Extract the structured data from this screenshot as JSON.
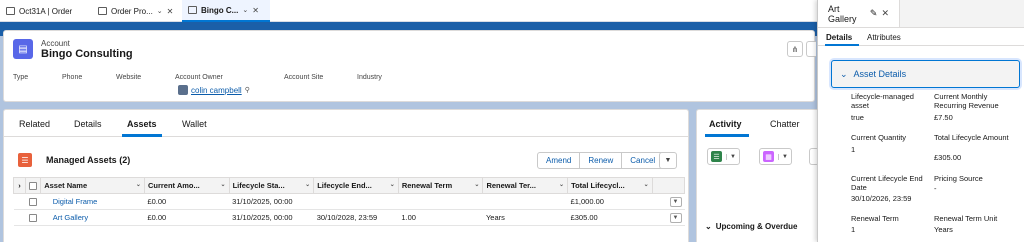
{
  "console_tabs": [
    {
      "label": "Oct31A | Order"
    },
    {
      "label": "Order Pro..."
    },
    {
      "label": "Bingo C..."
    }
  ],
  "header": {
    "object_type": "Account",
    "name": "Bingo Consulting",
    "fields": [
      "Type",
      "Phone",
      "Website",
      "Account Owner",
      "Account Site",
      "Industry"
    ],
    "owner": "colin campbell"
  },
  "related_tabs": [
    "Related",
    "Details",
    "Assets",
    "Wallet"
  ],
  "managed_assets": {
    "title": "Managed Assets (2)",
    "buttons": [
      "Amend",
      "Renew",
      "Cancel"
    ],
    "columns": [
      "Asset Name",
      "Current Amo...",
      "Lifecycle Sta...",
      "Lifecycle End...",
      "Renewal Term",
      "Renewal Ter...",
      "Total Lifecycl..."
    ],
    "rows": [
      {
        "name": "Digital Frame",
        "current_amount": "£0.00",
        "lifecycle_start": "31/10/2025, 00:00",
        "lifecycle_end": "",
        "renewal_term": "",
        "renewal_term_unit": "",
        "total_lifecycle": "£1,000.00"
      },
      {
        "name": "Art Gallery",
        "current_amount": "£0.00",
        "lifecycle_start": "31/10/2025, 00:00",
        "lifecycle_end": "30/10/2028, 23:59",
        "renewal_term": "1.00",
        "renewal_term_unit": "Years",
        "total_lifecycle": "£305.00"
      }
    ]
  },
  "activity": {
    "tabs": [
      "Activity",
      "Chatter"
    ],
    "upcoming": "Upcoming & Overdue"
  },
  "panel": {
    "title": "Art Gallery",
    "tabs": [
      "Details",
      "Attributes"
    ],
    "section": "Asset Details",
    "fields": [
      {
        "label": "Lifecycle-managed asset",
        "value": "true"
      },
      {
        "label": "Current Monthly Recurring Revenue",
        "value": "£7.50"
      },
      {
        "label": "Current Quantity",
        "value": "1"
      },
      {
        "label": "Total Lifecycle Amount",
        "value": "£305.00"
      },
      {
        "label": "Current Lifecycle End Date",
        "value": "30/10/2026, 23:59"
      },
      {
        "label": "Pricing Source",
        "value": "-"
      },
      {
        "label": "Renewal Term",
        "value": "1"
      },
      {
        "label": "Renewal Term Unit",
        "value": "Years"
      }
    ]
  },
  "colors": {
    "brand": "#0176d3",
    "link": "#0b5cab",
    "account_icon": "#5867e8",
    "assets_icon": "#e8613c"
  },
  "icons": [
    "account-icon",
    "assets-icon",
    "hierarchy-icon",
    "user-avatar-icon",
    "chevron-down-icon",
    "edit-pencil-icon",
    "close-icon"
  ]
}
